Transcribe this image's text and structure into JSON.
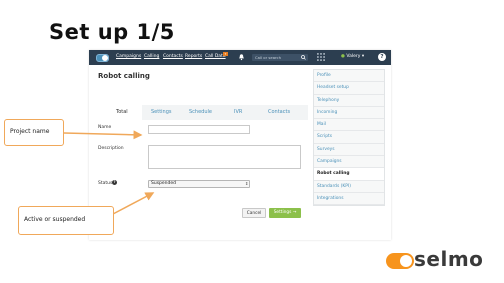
{
  "slide": {
    "title": "Set up 1/5"
  },
  "topbar": {
    "nav": [
      "Campaigns",
      "Calling",
      "Contacts",
      "Reports",
      "Call Data"
    ],
    "badge": "7",
    "search_placeholder": "Call or search",
    "user": "Valery"
  },
  "page": {
    "title": "Robot calling",
    "tabs": [
      "Total",
      "Settings",
      "Schedule",
      "IVR",
      "Contacts"
    ],
    "fields": {
      "name_label": "Name",
      "name_value": "",
      "description_label": "Description",
      "description_value": "",
      "status_label": "Status",
      "status_value": "Suspended"
    },
    "buttons": {
      "cancel": "Cancel",
      "settings": "Settings →"
    }
  },
  "sidebar": {
    "items": [
      "Profile",
      "Headset setup",
      "Telephony",
      "Incoming",
      "Mail",
      "Scripts",
      "Surveys",
      "Campaigns",
      "Robot calling",
      "Standards (KPI)",
      "Integrations"
    ],
    "active_index": 8
  },
  "callouts": {
    "project_name": "Project name",
    "active_suspended": "Active or suspended"
  },
  "logo": {
    "text": "selmo"
  },
  "colors": {
    "accent": "#f0a85a",
    "topbar": "#2c3e50",
    "link": "#4a90b8",
    "primary_button": "#8cc04b"
  }
}
